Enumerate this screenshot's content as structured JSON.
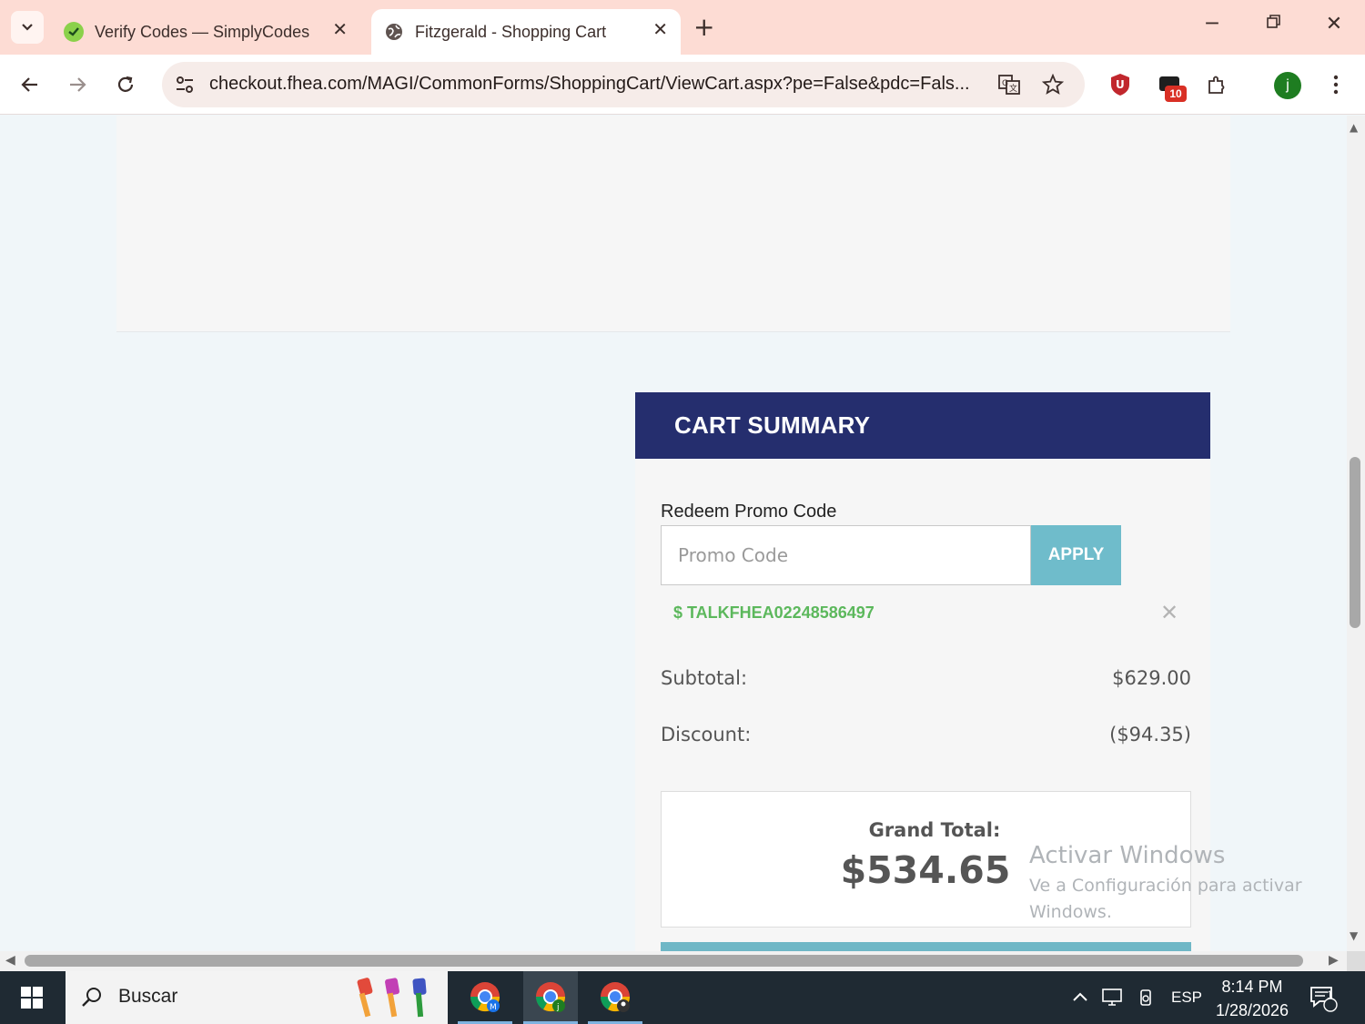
{
  "browser": {
    "tabs": [
      {
        "title": "Verify Codes — SimplyCodes",
        "active": false
      },
      {
        "title": "Fitzgerald - Shopping Cart",
        "active": true
      }
    ],
    "url": "checkout.fhea.com/MAGI/CommonForms/ShoppingCart/ViewCart.aspx?pe=False&pdc=Fals...",
    "extension_badge": "10",
    "profile_initial": "j"
  },
  "cart_summary": {
    "header": "CART SUMMARY",
    "promo_label": "Redeem Promo Code",
    "promo_placeholder": "Promo Code",
    "apply_label": "APPLY",
    "applied_code": "$ TALKFHEA02248586497",
    "remove_symbol": "✕",
    "subtotal_label": "Subtotal:",
    "subtotal_value": "$629.00",
    "discount_label": "Discount:",
    "discount_value": "($94.35)",
    "grand_total_label": "Grand Total:",
    "grand_total_value": "$534.65"
  },
  "watermark": {
    "line1": "Activar Windows",
    "line2": "Ve a Configuración para activar Windows."
  },
  "taskbar": {
    "search_placeholder": "Buscar",
    "language": "ESP",
    "time": "8:14 PM",
    "date": "1/28/2026",
    "notification_count": "1"
  },
  "colors": {
    "cart_header": "#252e6e",
    "apply_button": "#6fbccb",
    "applied_code": "#5cb85c",
    "tab_strip": "#fddcd4"
  }
}
